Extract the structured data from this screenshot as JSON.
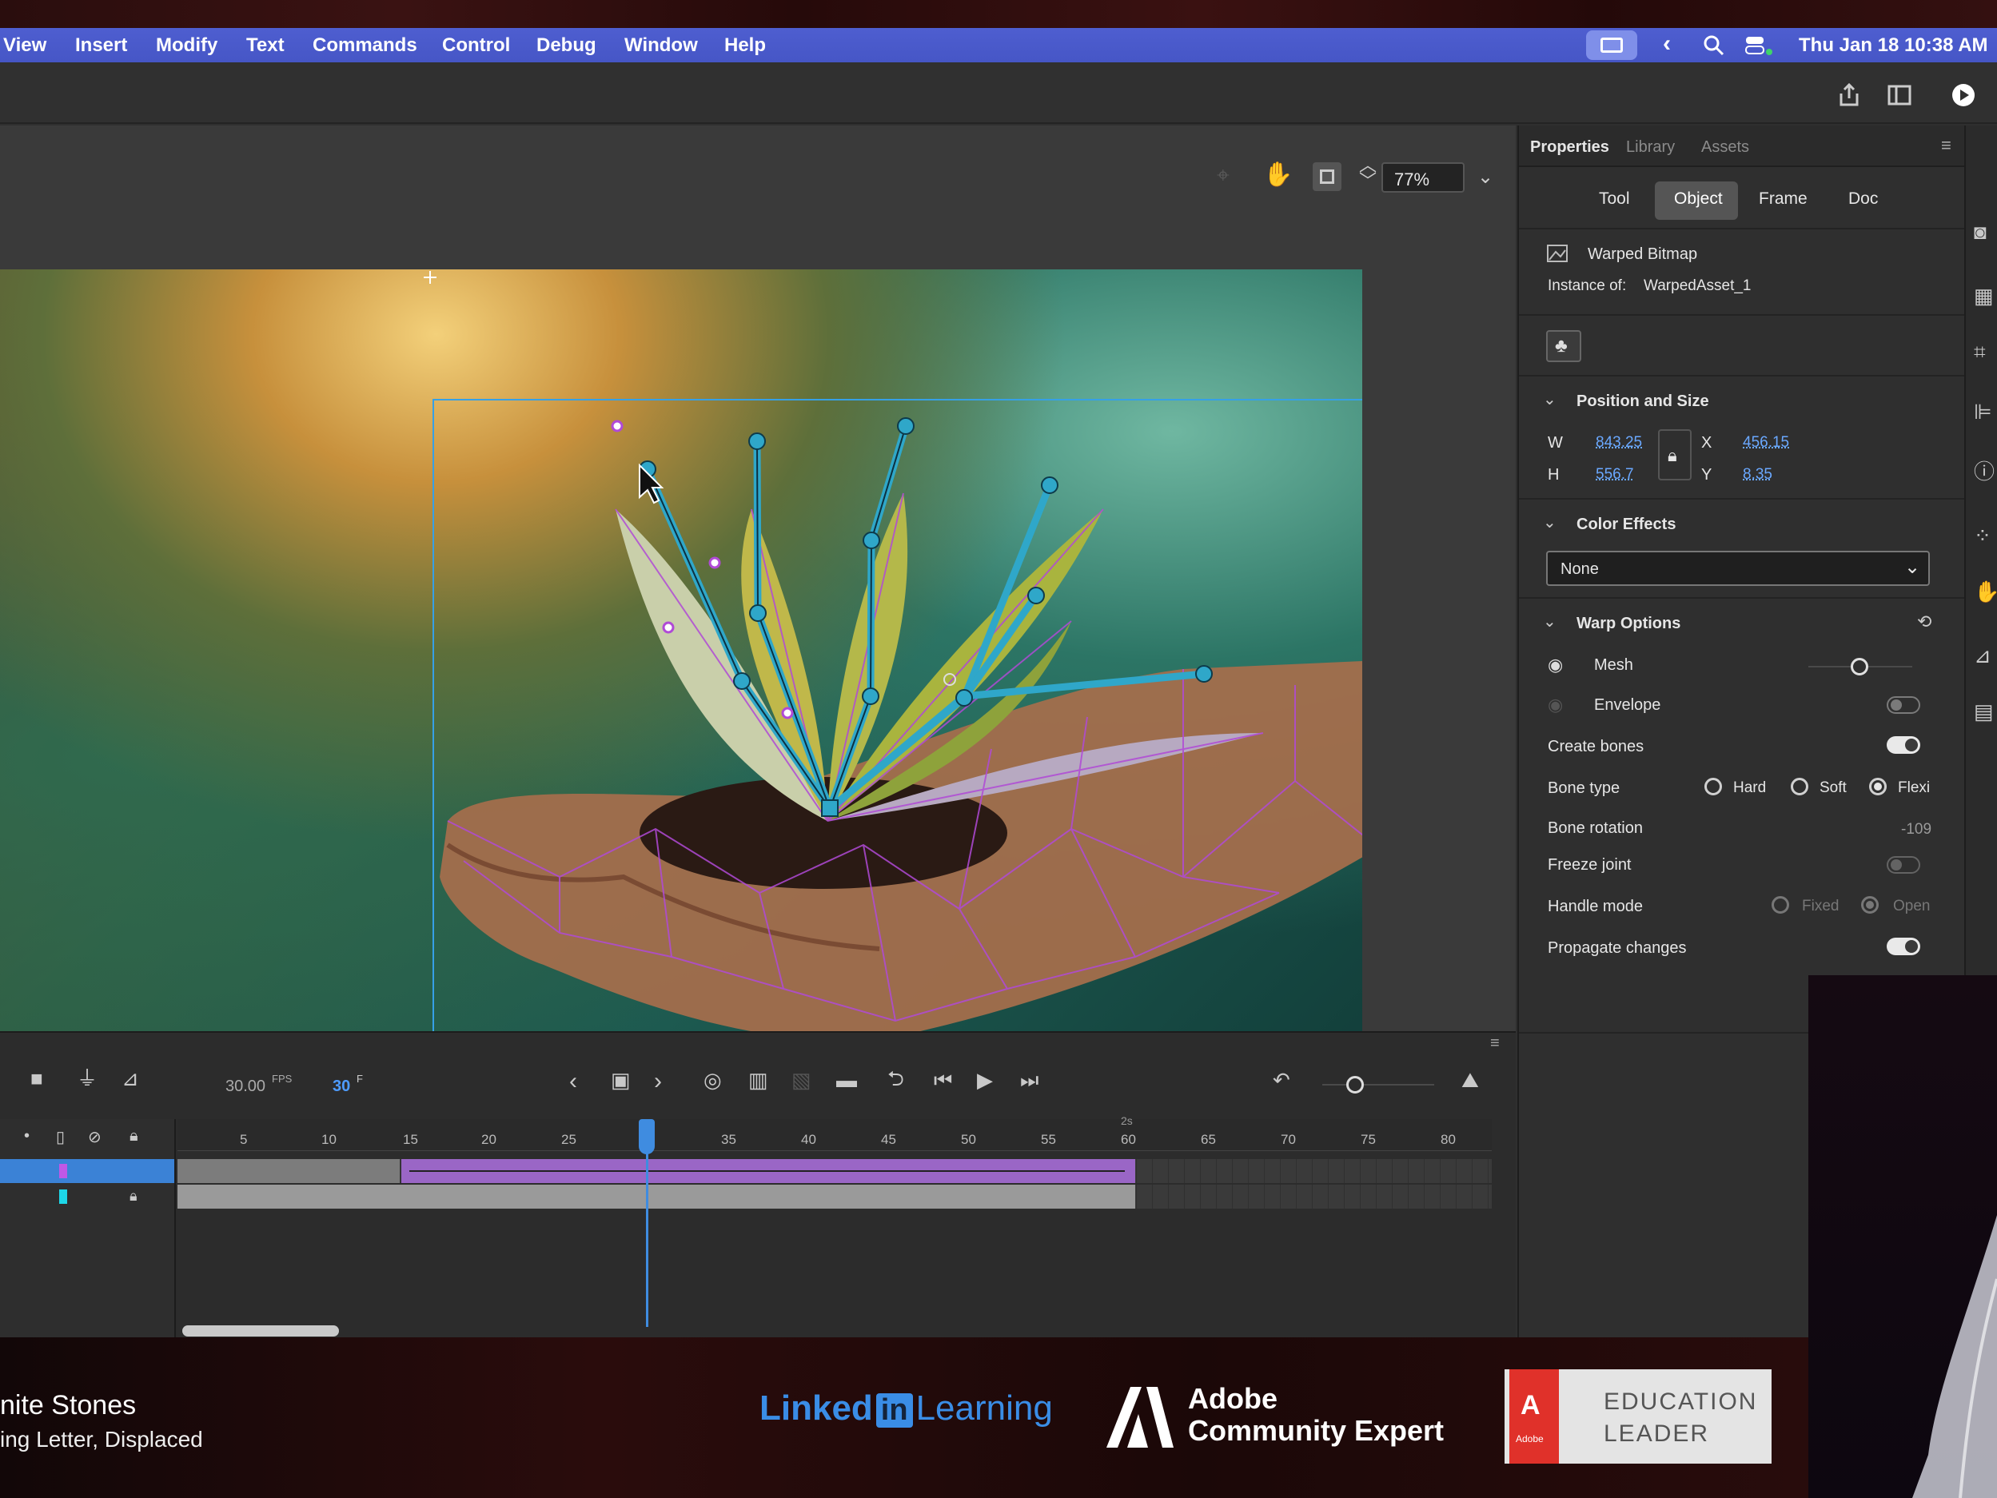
{
  "menubar": {
    "items": [
      "View",
      "Insert",
      "Modify",
      "Text",
      "Commands",
      "Control",
      "Debug",
      "Window",
      "Help"
    ],
    "clock": "Thu Jan 18  10:38 AM"
  },
  "stage": {
    "zoom": "77%"
  },
  "props": {
    "tabs": [
      "Properties",
      "Library",
      "Assets"
    ],
    "subtabs": [
      "Tool",
      "Object",
      "Frame",
      "Doc"
    ],
    "object_type": "Warped Bitmap",
    "instance_label": "Instance of:",
    "instance_name": "WarpedAsset_1",
    "pos_section": "Position and Size",
    "w_label": "W",
    "w": "843.25",
    "h_label": "H",
    "h": "556.7",
    "x_label": "X",
    "x": "456.15",
    "y_label": "Y",
    "y": "8.35",
    "color_section": "Color Effects",
    "color_value": "None",
    "warp_section": "Warp Options",
    "mesh": "Mesh",
    "envelope": "Envelope",
    "create_bones": "Create bones",
    "bone_type": "Bone type",
    "bone_types": [
      "Hard",
      "Soft",
      "Flexi"
    ],
    "bone_rotation": "Bone rotation",
    "bone_rotation_value": "-109",
    "freeze_joint": "Freeze joint",
    "handle_mode": "Handle mode",
    "handle_modes": [
      "Fixed",
      "Open"
    ],
    "propagate": "Propagate changes"
  },
  "timeline": {
    "fps": "30.00",
    "fps_unit": "FPS",
    "frame": "30",
    "frame_unit": "F",
    "ruler": [
      "5",
      "10",
      "15",
      "20",
      "25",
      "35",
      "40",
      "45",
      "50",
      "55",
      "60",
      "65",
      "70",
      "75",
      "80"
    ],
    "ruler_time": "2s"
  },
  "footer": {
    "title": "nite Stones",
    "subtitle": "ing Letter, Displaced",
    "linkedin_a": "Linked",
    "linkedin_in": "in",
    "linkedin_b": "Learning",
    "ace_1": "Adobe",
    "ace_2": "Community Expert",
    "edu_1": "EDUCATION",
    "edu_2": "LEADER",
    "adobe_mark": "Adobe"
  },
  "colors": {
    "accent": "#3f8ce0",
    "mesh": "#b04ad6",
    "bone": "#2fa7c9",
    "menubar": "#4a5ac9"
  }
}
